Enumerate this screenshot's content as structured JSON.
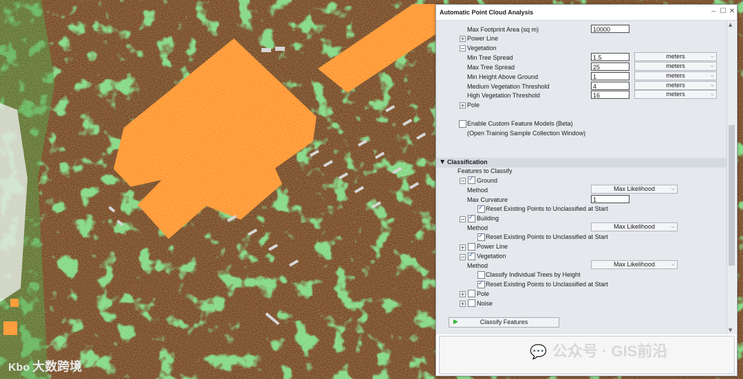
{
  "window": {
    "title": "Automatic Point Cloud Analysis"
  },
  "settings": {
    "max_footprint_label": "Max Footprint Area (sq m)",
    "max_footprint_value": "10000",
    "power_line_label": "Power Line",
    "vegetation_label": "Vegetation",
    "pole_label": "Pole",
    "veg_params": [
      {
        "label": "Min Tree Spread",
        "value": "1.5",
        "unit": "meters"
      },
      {
        "label": "Max Tree Spread",
        "value": "25",
        "unit": "meters"
      },
      {
        "label": "Min Height Above Ground",
        "value": "1",
        "unit": "meters"
      },
      {
        "label": "Medium Vegetation Threshold",
        "value": "4",
        "unit": "meters"
      },
      {
        "label": "High Vegetation Threshold",
        "value": "16",
        "unit": "meters"
      }
    ],
    "custom_models_label": "Enable Custom Feature Models (Beta)",
    "training_window_label": "(Open Training Sample Collection Window)"
  },
  "classification": {
    "section_title": "Classification",
    "features_label": "Features to Classify",
    "ground": {
      "label": "Ground",
      "method_label": "Method",
      "method_value": "Max Likelihood",
      "curvature_label": "Max Curvature",
      "curvature_value": "1",
      "reset_label": "Reset Existing Points to Unclassified at Start"
    },
    "building": {
      "label": "Building",
      "method_label": "Method",
      "method_value": "Max Likelihood",
      "reset_label": "Reset Existing Points to Unclassified at Start"
    },
    "power_line": {
      "label": "Power Line"
    },
    "vegetation": {
      "label": "Vegetation",
      "method_label": "Method",
      "method_value": "Max Likelihood",
      "individual_trees_label": "Classify Individual Trees by Height",
      "reset_label": "Reset Existing Points to Unclassified at Start"
    },
    "pole": {
      "label": "Pole"
    },
    "noise": {
      "label": "Noise"
    },
    "classify_button": "Classify Features"
  },
  "watermarks": {
    "left": "大数跨境",
    "right": "公众号 · GIS前沿"
  },
  "colors": {
    "ground": "#6b3a10",
    "building": "#ff8c1a",
    "vegetation": "#2ea82e",
    "panel_bg": "#e5e8ec"
  }
}
